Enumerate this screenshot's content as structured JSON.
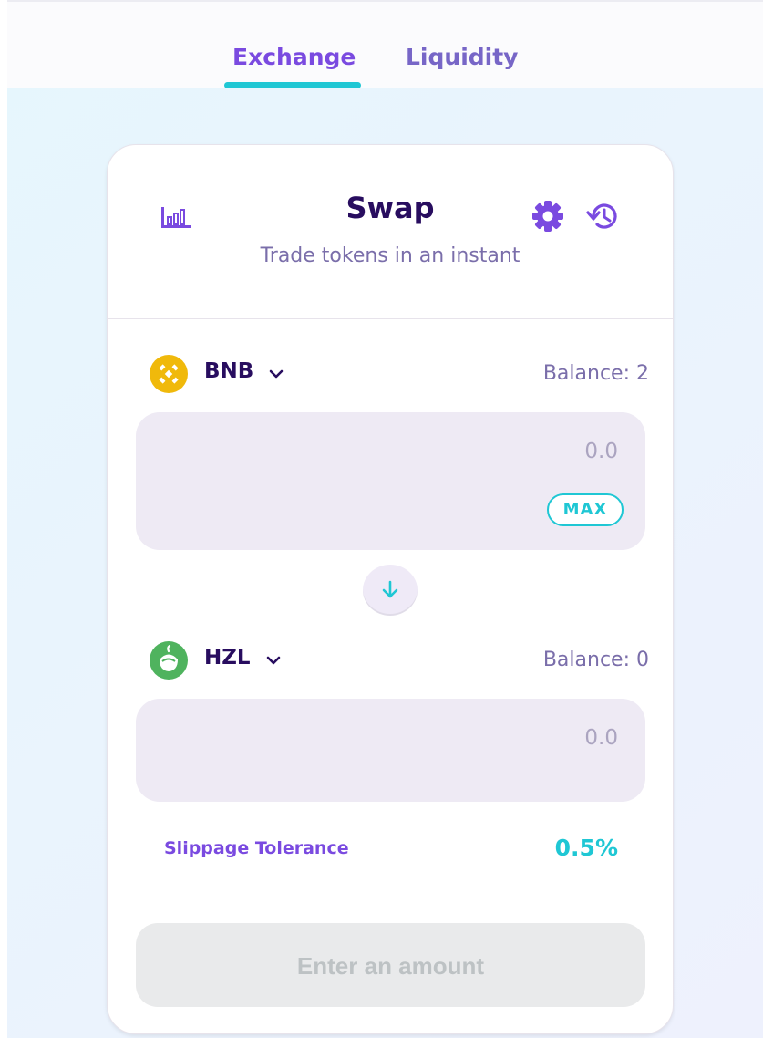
{
  "nav": {
    "tabs": [
      {
        "label": "Exchange",
        "active": true
      },
      {
        "label": "Liquidity",
        "active": false
      }
    ]
  },
  "swap": {
    "title": "Swap",
    "subtitle": "Trade tokens in an instant",
    "icons": {
      "chart": "chart-icon",
      "settings": "gear-icon",
      "history": "history-icon"
    },
    "from": {
      "token": "BNB",
      "token_icon": "bnb-coin-icon",
      "balance": "Balance: 2",
      "amount": "0.0",
      "max_label": "MAX"
    },
    "to": {
      "token": "HZL",
      "token_icon": "hzl-coin-icon",
      "balance": "Balance: 0",
      "amount": "0.0"
    },
    "slippage": {
      "label": "Slippage Tolerance",
      "value": "0.5%"
    },
    "action_label": "Enter an amount"
  },
  "colors": {
    "primary_purple": "#7a4ae0",
    "accent_teal": "#1fc7d4",
    "heading": "#280d5f",
    "muted": "#7a6eaa",
    "input_bg": "#eeeaf4",
    "bnb_yellow": "#f0b90b",
    "hzl_green": "#4fb35e"
  }
}
